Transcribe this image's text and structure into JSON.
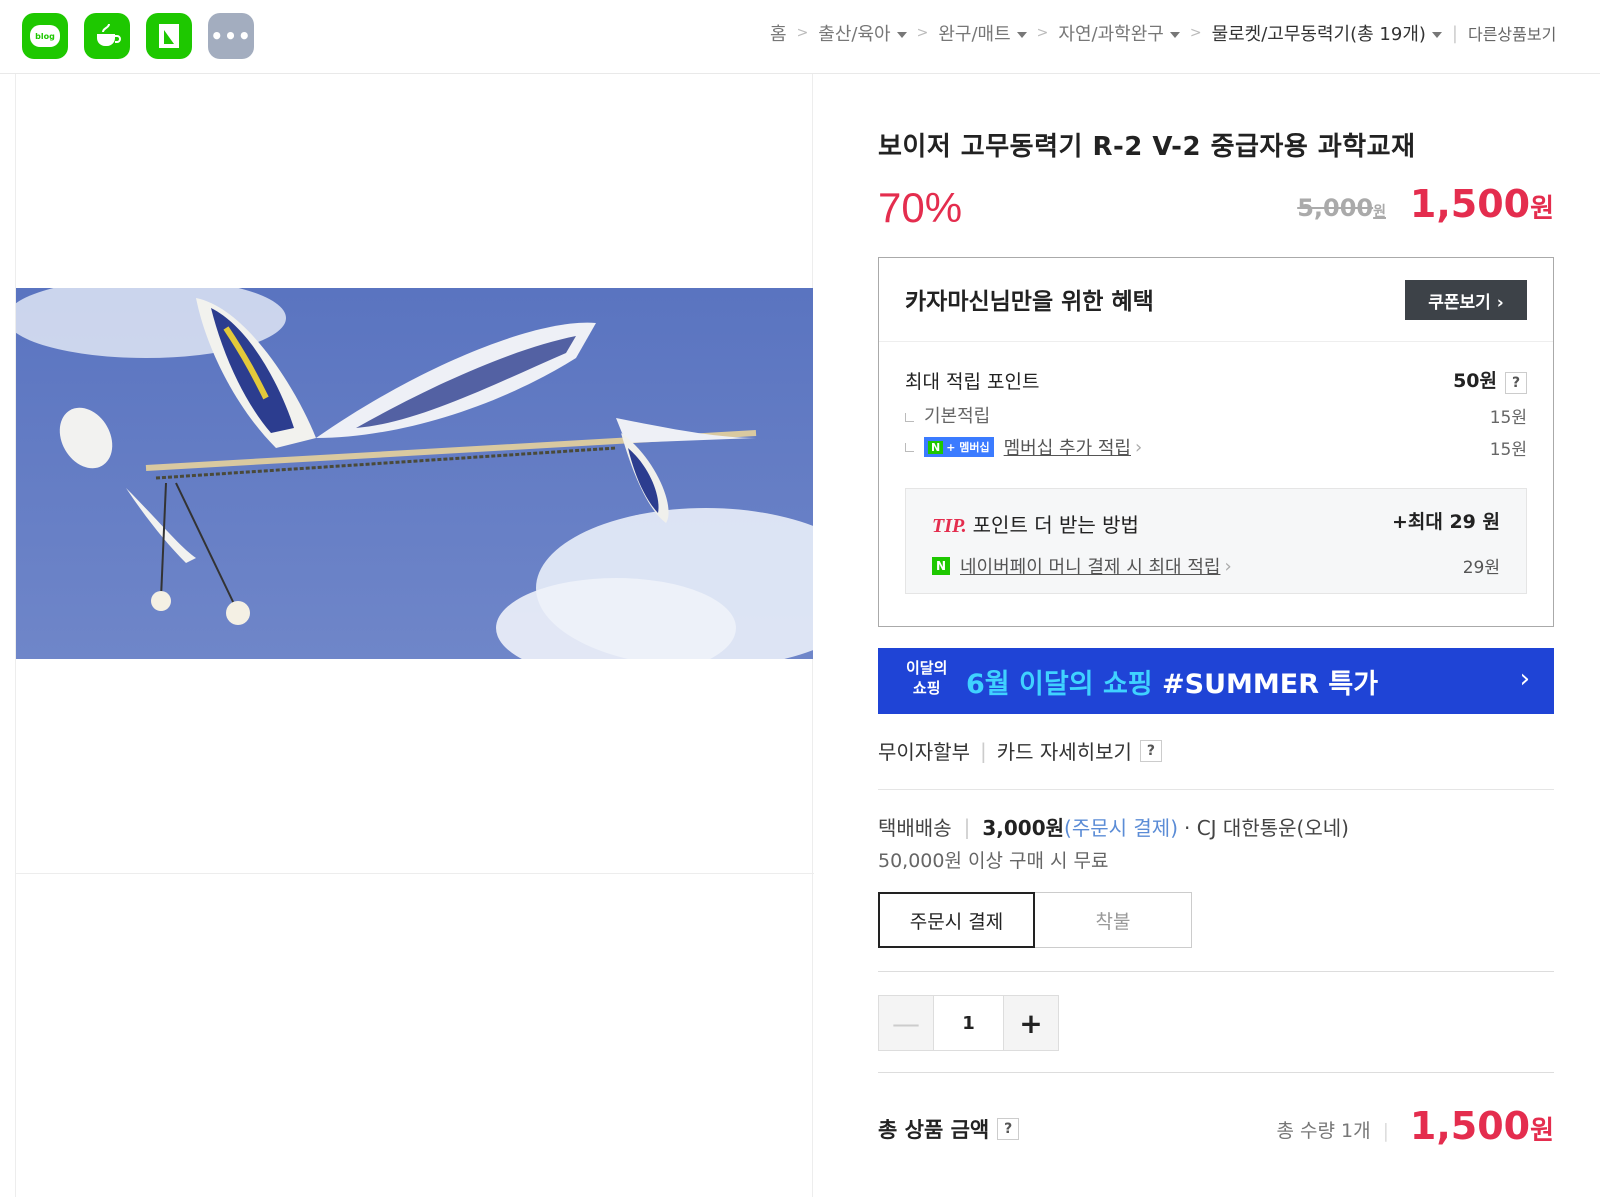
{
  "share": {
    "blog_label": "blog",
    "more_label": "•••"
  },
  "breadcrumb": {
    "home": "홈",
    "cat1": "출산/육아",
    "cat2": "완구/매트",
    "cat3": "자연/과학완구",
    "cat4": "물로켓/고무동력기(총 19개)",
    "other": "다른상품보기"
  },
  "product": {
    "title": "보이저 고무동력기 R-2 V-2 중급자용 과학교재",
    "discount": "70%",
    "original_price": "5,000",
    "original_unit": "원",
    "sale_price": "1,500",
    "sale_unit": "원"
  },
  "benefit": {
    "title": "카자마신님만을 위한 혜택",
    "coupon_button": "쿠폰보기 ›",
    "max_points_label": "최대 적립 포인트",
    "max_points_value": "50원",
    "help": "?",
    "basic_label": "기본적립",
    "basic_value": "15원",
    "membership_badge_n": "N",
    "membership_badge_text": "+ 멤버십",
    "membership_label": "멤버십 추가 적립",
    "membership_value": "15원",
    "chevron": "›"
  },
  "tip": {
    "tip_prefix": "TIP.",
    "title": "포인트 더 받는 방법",
    "max": "+최대 29 원",
    "npay_icon": "N",
    "npay_label": "네이버페이 머니 결제 시 최대 적립",
    "npay_value": "29원"
  },
  "banner": {
    "badge_line1": "이달의",
    "badge_line2": "쇼핑",
    "highlight": "6월 이달의 쇼핑",
    "text": " #SUMMER 특가",
    "arrow": "›"
  },
  "installment": {
    "label": "무이자할부",
    "card_detail": "카드 자세히보기",
    "help": "?"
  },
  "shipping": {
    "method": "택배배송",
    "fee": "3,000원",
    "fee_note": "(주문시 결제)",
    "carrier": "· CJ 대한통운(오네)",
    "free_condition": "50,000원 이상 구매 시 무료",
    "option_prepaid": "주문시 결제",
    "option_cod": "착불"
  },
  "quantity": {
    "minus": "—",
    "value": "1",
    "plus": "+"
  },
  "total": {
    "label": "총 상품 금액",
    "help": "?",
    "count": "총 수량 1개",
    "price": "1,500",
    "unit": "원"
  },
  "colors": {
    "accent_red": "#e42d4e",
    "naver_green": "#1ec800",
    "banner_blue": "#1f44d6"
  }
}
